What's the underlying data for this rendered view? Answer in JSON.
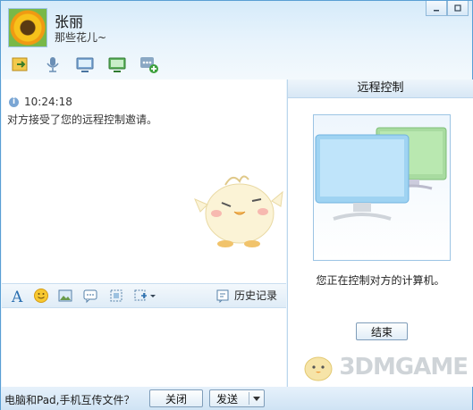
{
  "contact": {
    "name": "张丽",
    "signature": "那些花儿~"
  },
  "window_buttons": [
    "minimize-icon",
    "maximize-icon"
  ],
  "toolbar": [
    "file-transfer-icon",
    "microphone-icon",
    "video-icon",
    "remote-desktop-icon",
    "app-add-icon"
  ],
  "chat": {
    "time": "10:24:18",
    "message": "对方接受了您的远程控制邀请。"
  },
  "format_bar": {
    "history": "历史记录"
  },
  "bottom": {
    "tip": "电脑和Pad,手机互传文件？",
    "close": "关闭",
    "send": "发送"
  },
  "remote_panel": {
    "title": "远程控制",
    "status": "您正在控制对方的计算机。",
    "end": "结束"
  },
  "watermark": "3DMGAME",
  "colors": {
    "accent": "#5a9fd4",
    "title_bar": "#d6ebfa"
  }
}
